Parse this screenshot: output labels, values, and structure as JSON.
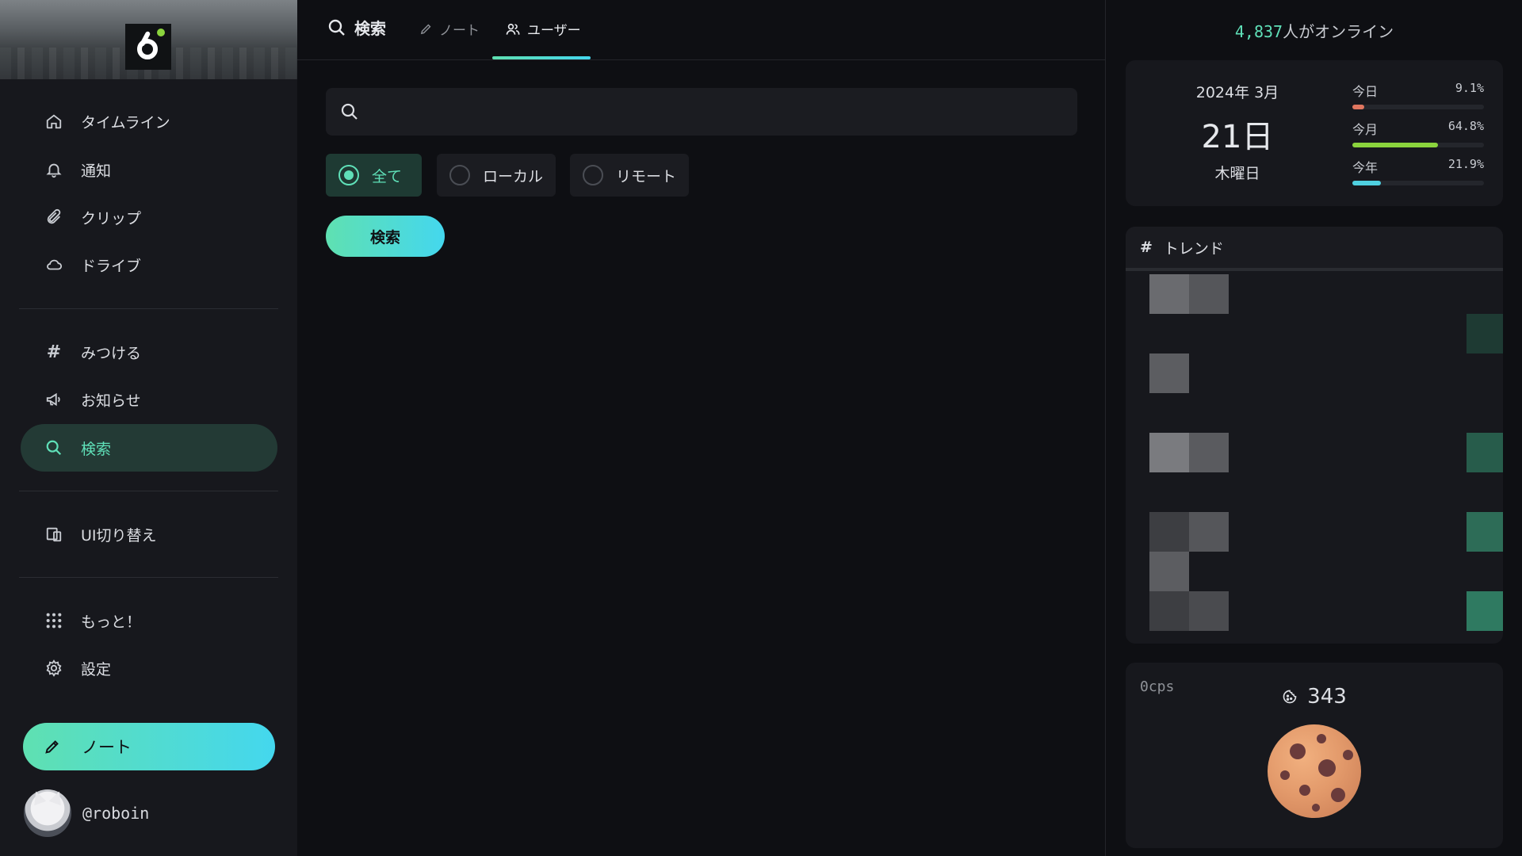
{
  "sidebar": {
    "items": [
      {
        "label": "タイムライン",
        "icon": "home-icon"
      },
      {
        "label": "通知",
        "icon": "bell-icon"
      },
      {
        "label": "クリップ",
        "icon": "paperclip-icon"
      },
      {
        "label": "ドライブ",
        "icon": "cloud-icon"
      },
      {
        "label": "みつける",
        "icon": "hash-icon"
      },
      {
        "label": "お知らせ",
        "icon": "megaphone-icon"
      },
      {
        "label": "検索",
        "icon": "search-icon",
        "active": true
      },
      {
        "label": "UI切り替え",
        "icon": "devices-icon"
      },
      {
        "label": "もっと！",
        "icon": "grid-dots-icon"
      },
      {
        "label": "設定",
        "icon": "gear-icon"
      }
    ],
    "note_button": "ノート",
    "account_handle": "@roboin"
  },
  "main": {
    "title": "検索",
    "tabs": [
      {
        "label": "ノート",
        "icon": "pencil-icon"
      },
      {
        "label": "ユーザー",
        "icon": "users-icon",
        "active": true
      }
    ],
    "search": {
      "value": "",
      "placeholder": ""
    },
    "origin_options": [
      {
        "label": "全て",
        "checked": true
      },
      {
        "label": "ローカル",
        "checked": false
      },
      {
        "label": "リモート",
        "checked": false
      }
    ],
    "search_button": "検索"
  },
  "right": {
    "online_count": "4,837",
    "online_suffix": "人がオンライン",
    "calendar": {
      "year_month": "2024年 3月",
      "day": "21日",
      "weekday": "木曜日",
      "progress": [
        {
          "label": "今日",
          "percent_text": "9.1%",
          "value": 9.1,
          "color": "#e0765f"
        },
        {
          "label": "今月",
          "percent_text": "64.8%",
          "value": 64.8,
          "color": "#8bd43d"
        },
        {
          "label": "今年",
          "percent_text": "21.9%",
          "value": 21.9,
          "color": "#4fd0e0"
        }
      ]
    },
    "trend": {
      "title": "トレンド"
    },
    "cookie": {
      "cps": "0cps",
      "count": "343"
    }
  },
  "colors": {
    "accent": "#5fe0b8",
    "accent_gradient_end": "#44d7ee",
    "background": "#0e0f13",
    "panel": "#17181d"
  }
}
